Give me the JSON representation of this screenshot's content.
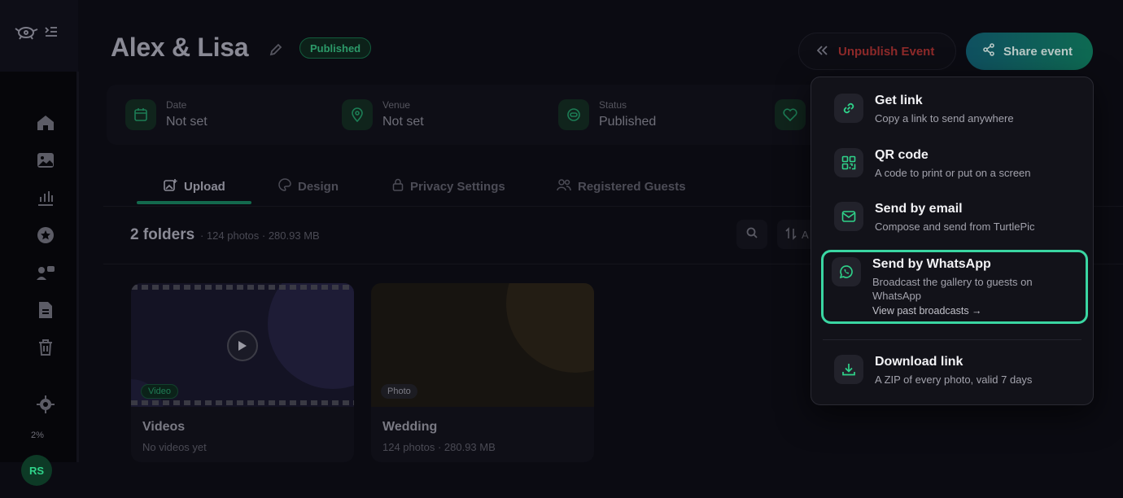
{
  "event": {
    "title": "Alex & Lisa",
    "status_badge": "Published"
  },
  "header": {
    "unpublish_label": "Unpublish Event",
    "share_label": "Share event"
  },
  "info": {
    "date_label": "Date",
    "date_value": "Not set",
    "venue_label": "Venue",
    "venue_value": "Not set",
    "status_label": "Status",
    "status_value": "Published"
  },
  "tabs": [
    {
      "label": "Upload"
    },
    {
      "label": "Design"
    },
    {
      "label": "Privacy Settings"
    },
    {
      "label": "Registered Guests"
    }
  ],
  "toolbar": {
    "folder_count": "2 folders",
    "folder_meta": "· 124 photos · 280.93 MB",
    "sort_label": "A"
  },
  "folders": [
    {
      "name": "Videos",
      "sub": "No videos yet",
      "chip": "Video"
    },
    {
      "name": "Wedding",
      "sub": "124 photos · 280.93 MB",
      "chip": "Photo"
    }
  ],
  "sidebar": {
    "zoom": "2%",
    "avatar_initials": "RS"
  },
  "share_menu": {
    "items": [
      {
        "title": "Get link",
        "desc": "Copy a link to send anywhere",
        "icon": "link-icon"
      },
      {
        "title": "QR code",
        "desc": "A code to print or put on a screen",
        "icon": "qr-code-icon"
      },
      {
        "title": "Send by email",
        "desc": "Compose and send from TurtlePic",
        "icon": "mail-icon"
      },
      {
        "title": "Send by WhatsApp",
        "desc": "Broadcast the gallery to guests on WhatsApp",
        "link": "View past broadcasts →",
        "icon": "whatsapp-icon"
      },
      {
        "title": "Download link",
        "desc": "A ZIP of every photo, valid 7 days",
        "icon": "download-icon"
      }
    ]
  },
  "colors": {
    "accent": "#2fd38a",
    "highlight_border": "#3ad6a2",
    "danger": "#8e2a2a"
  }
}
